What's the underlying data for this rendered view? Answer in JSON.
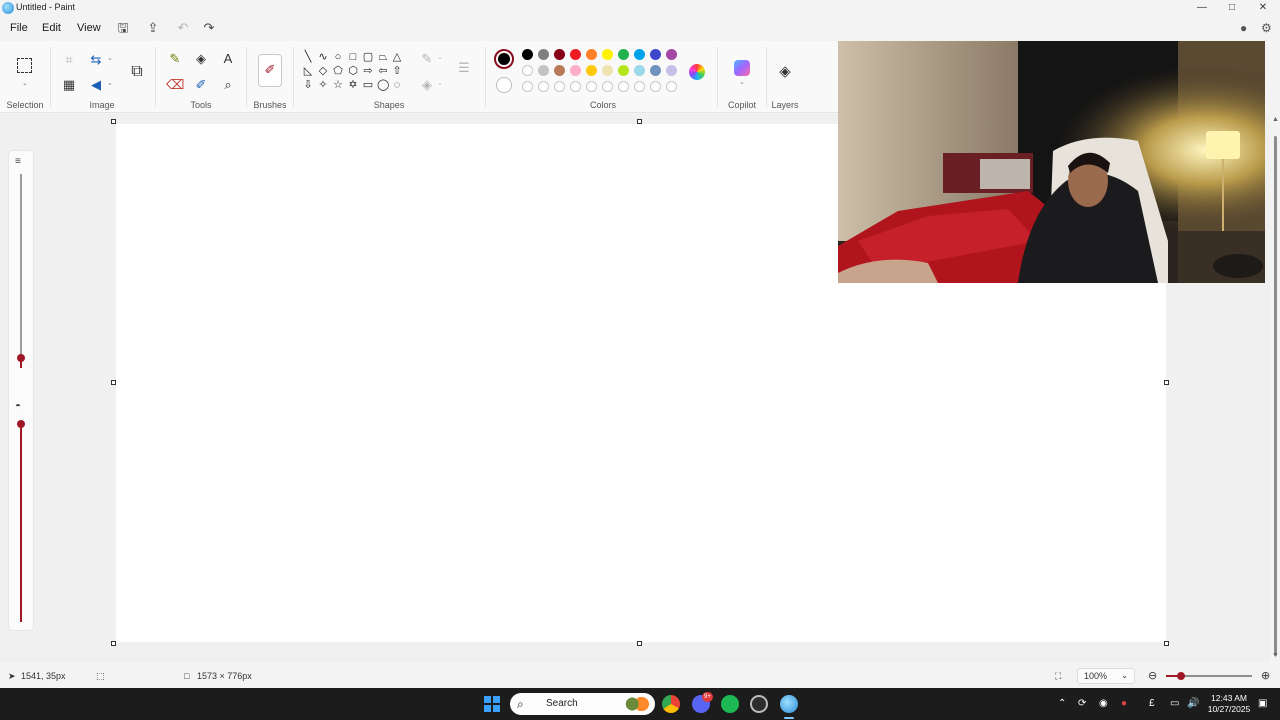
{
  "window": {
    "title": "Untitled - Paint",
    "minimize_glyph": "—",
    "maximize_glyph": "□",
    "close_glyph": "✕"
  },
  "menu": {
    "file": "File",
    "edit": "Edit",
    "view": "View"
  },
  "ribbon": {
    "groups": {
      "selection": "Selection",
      "image": "Image",
      "tools": "Tools",
      "brushes": "Brushes",
      "shapes": "Shapes",
      "colors": "Colors",
      "copilot": "Copilot",
      "layers": "Layers"
    },
    "text_tool_glyph": "A",
    "primary_color": "#000000",
    "secondary_color": "#ffffff",
    "palette_row1": [
      "#000000",
      "#7f7f7f",
      "#880015",
      "#ed1c24",
      "#ff7f27",
      "#fff200",
      "#22b14c",
      "#00a2e8",
      "#3f48cc",
      "#a349a4"
    ],
    "palette_row2": [
      "#ffffff",
      "#c3c3c3",
      "#b97a57",
      "#ffaec9",
      "#ffc90e",
      "#efe4b0",
      "#b5e61d",
      "#99d9ea",
      "#7092be",
      "#c8bfe7"
    ],
    "palette_row3_count": 10,
    "accent": "#a01825"
  },
  "status": {
    "cursor_position": "1541, 35px",
    "canvas_size": "1573 × 776px",
    "zoom": "100%",
    "zoom_level_fraction": 0.17
  },
  "brush_size_fraction": 0.05,
  "opacity_fraction": 1.0,
  "taskbar": {
    "search_placeholder": "Search",
    "time": "12:43 AM",
    "date": "10/27/2025",
    "lang": "£",
    "discord_badge": "9+"
  }
}
